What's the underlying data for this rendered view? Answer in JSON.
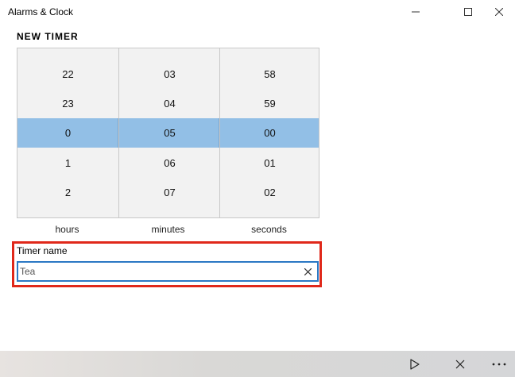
{
  "window": {
    "title": "Alarms & Clock"
  },
  "timer": {
    "section_title": "NEW TIMER",
    "hours": {
      "items": [
        "22",
        "23",
        "0",
        "1",
        "2"
      ],
      "label": "hours"
    },
    "minutes": {
      "items": [
        "03",
        "04",
        "05",
        "06",
        "07"
      ],
      "label": "minutes"
    },
    "seconds": {
      "items": [
        "58",
        "59",
        "00",
        "01",
        "02"
      ],
      "label": "seconds"
    },
    "selected": {
      "hours": "0",
      "minutes": "05",
      "seconds": "00"
    },
    "name_label": "Timer name",
    "name_value": "Tea"
  },
  "colors": {
    "selection": "#92bfe6",
    "highlight_border": "#e0281a",
    "input_border": "#2b78c4"
  },
  "icons": {
    "minimize": "minimize-icon",
    "maximize": "maximize-icon",
    "close": "close-icon",
    "clear": "clear-icon",
    "play": "play-icon",
    "cancel": "cancel-icon",
    "more": "more-icon"
  }
}
